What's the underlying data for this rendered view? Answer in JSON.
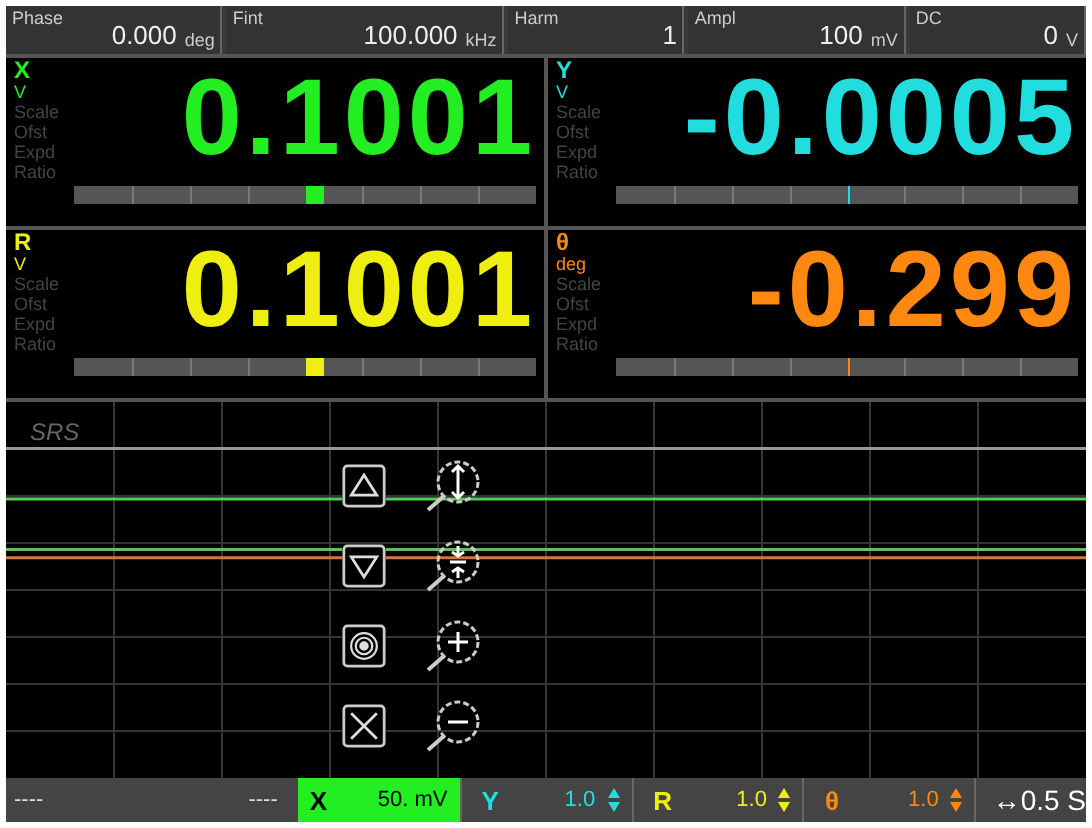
{
  "parameters": [
    {
      "label": "Phase",
      "value": "0.000",
      "unit": "deg"
    },
    {
      "label": "Fint",
      "value": "100.000",
      "unit": "kHz"
    },
    {
      "label": "Harm",
      "value": "1"
    },
    {
      "label": "Ampl",
      "value": "100",
      "unit": "mV"
    },
    {
      "label": "DC",
      "value": "0",
      "unit": "V"
    }
  ],
  "channels": [
    {
      "name": "X",
      "unit": "V",
      "value": "0.1001",
      "color": "#22ee22",
      "labels": [
        "Scale",
        "Ofst",
        "Expd",
        "Ratio"
      ],
      "level": 0.52,
      "kind": "block"
    },
    {
      "name": "Y",
      "unit": "V",
      "value": "-0.0005",
      "color": "#22dddd",
      "labels": [
        "Scale",
        "Ofst",
        "Expd",
        "Ratio"
      ],
      "level": 0.5,
      "kind": "line"
    },
    {
      "name": "R",
      "unit": "V",
      "value": "0.1001",
      "color": "#eeee11",
      "labels": [
        "Scale",
        "Ofst",
        "Expd",
        "Ratio"
      ],
      "level": 0.52,
      "kind": "block"
    },
    {
      "name": "θ",
      "unit": "deg",
      "value": "-0.299",
      "color": "#ff8811",
      "labels": [
        "Scale",
        "Ofst",
        "Expd",
        "Ratio"
      ],
      "level": 0.5,
      "kind": "line"
    }
  ],
  "graph": {
    "logo": "SRS"
  },
  "bottom_bar": {
    "left": "----",
    "left_2": "----",
    "scales": [
      {
        "name": "X",
        "value": "50. mV",
        "color": "#22ee22",
        "selected": true
      },
      {
        "name": "Y",
        "value": "1.0",
        "color": "#22dddd",
        "selected": false
      },
      {
        "name": "R",
        "value": "1.0",
        "color": "#eeee11",
        "selected": false
      },
      {
        "name": "θ",
        "value": "1.0",
        "color": "#ff8811",
        "selected": false
      }
    ],
    "time": "↔0.5 S"
  }
}
